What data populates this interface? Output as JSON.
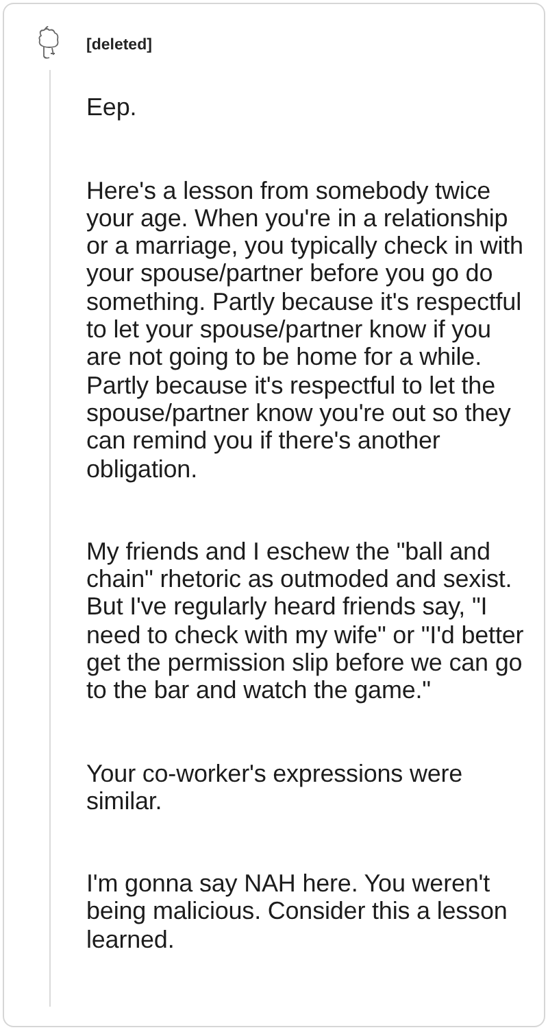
{
  "comment": {
    "author": "[deleted]",
    "paragraphs": [
      "Eep.",
      "Here's a lesson from somebody twice your age. When you're in a relationship or a marriage, you typically check in with your spouse/partner before you go do something. Partly because it's respectful to let your spouse/partner know if you are not going to be home for a while. Partly because it's respectful to let the spouse/partner know you're out so they can remind you if there's another obligation.",
      "My friends and I eschew the \"ball and chain\" rhetoric as outmoded and sexist. But I've regularly heard friends say, \"I need to check with my wife\" or \"I'd better get the permission slip before we can go to the bar and watch the game.\"",
      "Your co-worker's expressions were similar.",
      "I'm gonna say NAH here. You weren't being malicious. Consider this a lesson learned."
    ]
  }
}
